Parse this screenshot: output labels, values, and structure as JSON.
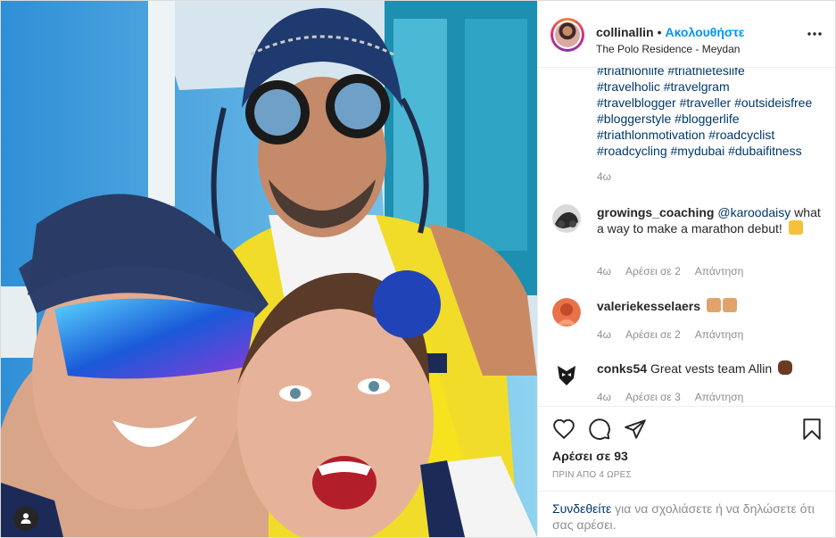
{
  "post": {
    "username": "collinallin",
    "separator": "•",
    "follow_label": "Ακολουθήστε",
    "location": "The Polo Residence - Meydan",
    "more_icon": "more-options-icon"
  },
  "caption": {
    "hashtag_lines": [
      "#triathlonlife #triathletesiife",
      "#travelholic #travelgram",
      "#travelblogger #traveller #outsideisfree",
      "#bloggerstyle #bloggerlife",
      "#triathlonmotivation #roadcyclist",
      "#roadcycling #mydubai #dubaifitness"
    ],
    "time": "4ω"
  },
  "comments": [
    {
      "username": "growings_coaching",
      "mention": "@karoodaisy",
      "text": "what a way to make a marathon debut!",
      "emoji": "flexed-biceps-emoji",
      "time": "4ω",
      "likes_label": "Αρέσει σε 2",
      "reply_label": "Απάντηση"
    },
    {
      "username": "valeriekesselaers",
      "mention": "",
      "text": "",
      "emoji": "raising-hands-emoji",
      "time": "4ω",
      "likes_label": "Αρέσει σε 2",
      "reply_label": "Απάντηση"
    },
    {
      "username": "conks54",
      "mention": "",
      "text": "Great vests team Allin",
      "emoji": "fist-emoji",
      "time": "4ω",
      "likes_label": "Αρέσει σε 3",
      "reply_label": "Απάντηση"
    }
  ],
  "actions": {
    "likes_text": "Αρέσει σε 93",
    "date_text": "ΠΡΙΝ ΑΠΟ 4 ΩΡΕΣ"
  },
  "login": {
    "link_text": "Συνδεθείτε",
    "rest_text": "για να σχολιάσετε ή να δηλώσετε ότι σας αρέσει."
  },
  "colors": {
    "link_blue": "#00376b",
    "follow_blue": "#0095f6",
    "muted": "#8e8e8e",
    "text": "#262626",
    "border": "#efefef"
  }
}
